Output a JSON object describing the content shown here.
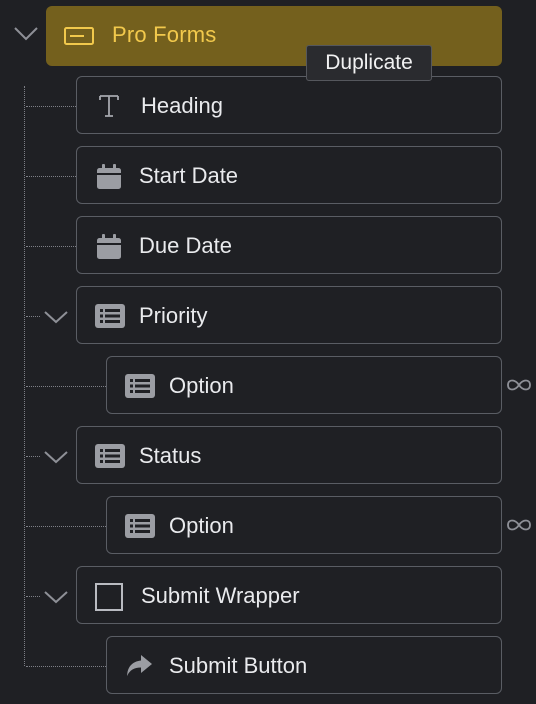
{
  "tooltip": "Duplicate",
  "root": {
    "label": "Pro Forms",
    "icon": "form-icon",
    "accent": "#f2c94c",
    "background": "#74601d"
  },
  "items": [
    {
      "label": "Heading",
      "icon": "text-t-icon"
    },
    {
      "label": "Start Date",
      "icon": "calendar-icon"
    },
    {
      "label": "Due Date",
      "icon": "calendar-icon"
    },
    {
      "label": "Priority",
      "icon": "list-icon",
      "expandable": true
    },
    {
      "label": "Option",
      "icon": "list-icon",
      "loop": true
    },
    {
      "label": "Status",
      "icon": "list-icon",
      "expandable": true
    },
    {
      "label": "Option",
      "icon": "list-icon",
      "loop": true
    },
    {
      "label": "Submit Wrapper",
      "icon": "square-icon",
      "expandable": true
    },
    {
      "label": "Submit Button",
      "icon": "share-arrow-icon"
    }
  ]
}
